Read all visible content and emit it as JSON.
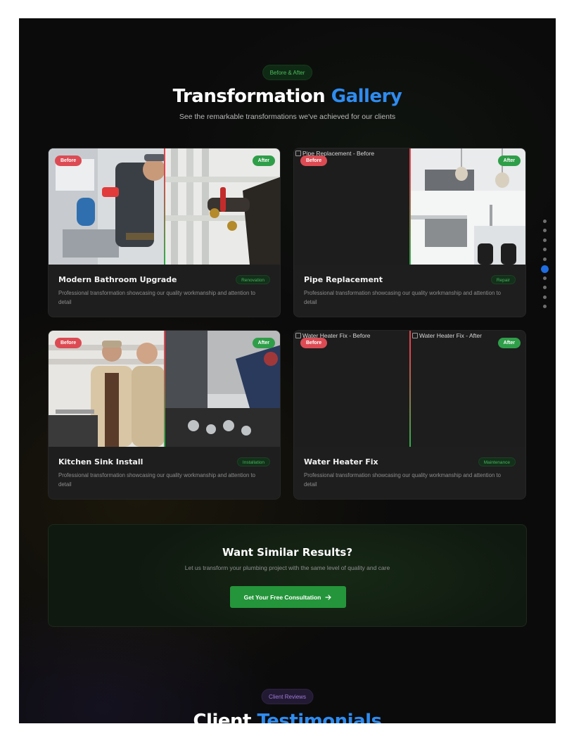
{
  "gallery": {
    "badge": "Before & After",
    "title_main": "Transformation ",
    "title_accent": "Gallery",
    "subtitle": "See the remarkable transformations we've achieved for our clients",
    "before_label": "Before",
    "after_label": "After",
    "description": "Professional transformation showcasing our quality workmanship and attention to detail",
    "items": [
      {
        "title": "Modern Bathroom Upgrade",
        "tag": "Renovation"
      },
      {
        "title": "Pipe Replacement",
        "tag": "Repair",
        "before_alt": "Pipe Replacement - Before"
      },
      {
        "title": "Kitchen Sink Install",
        "tag": "Installation"
      },
      {
        "title": "Water Heater Fix",
        "tag": "Maintenance",
        "before_alt": "Water Heater Fix - Before",
        "after_alt": "Water Heater Fix - After"
      }
    ]
  },
  "cta": {
    "title": "Want Similar Results?",
    "subtitle": "Let us transform your plumbing project with the same level of quality and care",
    "button_label": "Get Your Free Consultation",
    "button_icon": "arrow-right-icon"
  },
  "testimonials": {
    "badge": "Client Reviews",
    "title_main": "Client ",
    "title_accent": "Testimonials"
  },
  "section_nav": {
    "total": 10,
    "active_index": 5
  },
  "colors": {
    "accent_blue": "#2f8cf0",
    "before_red": "#dc4b53",
    "after_green": "#2f9e49",
    "cta_green": "#24953a",
    "background": "#0b0b0b"
  }
}
